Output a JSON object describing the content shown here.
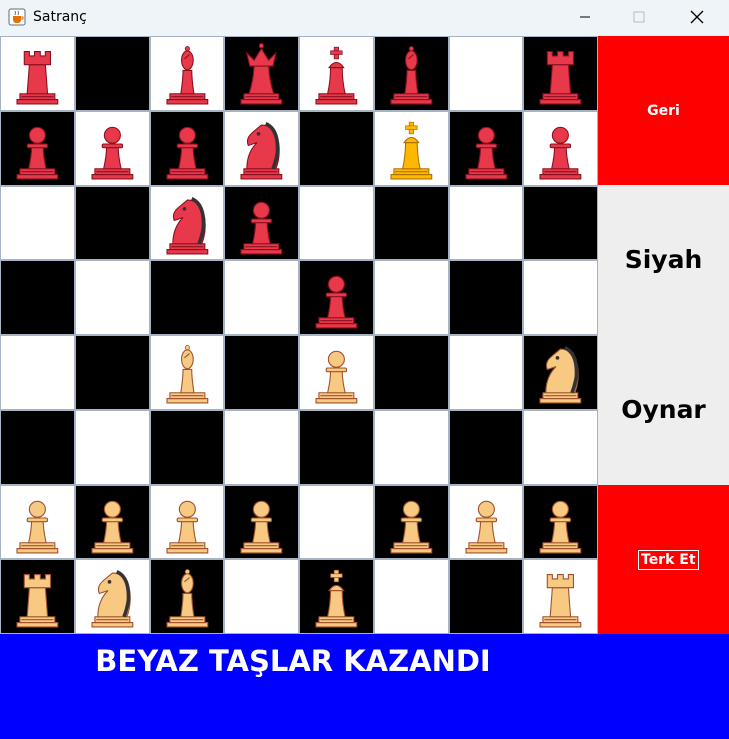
{
  "window": {
    "title": "Satranç",
    "icon": "java-cup-icon"
  },
  "colors": {
    "red_piece": "#e8394b",
    "white_piece": "#f7c982",
    "highlight_king": "#ffb800",
    "button_red": "#ff0000",
    "banner_blue": "#0000ff"
  },
  "side_panel": {
    "back_button_label": "Geri",
    "turn_line1": "Siyah",
    "turn_line2": "Oynar",
    "resign_button_label": "Terk Et"
  },
  "banner": {
    "message": "BEYAZ TAŞLAR KAZANDI"
  },
  "board": [
    [
      "R-rook",
      "",
      "R-bishop",
      "R-queen",
      "R-king",
      "R-bishop",
      "",
      "R-rook"
    ],
    [
      "R-pawn",
      "R-pawn",
      "R-pawn",
      "R-knight",
      "",
      "Y-king",
      "R-pawn",
      "R-pawn"
    ],
    [
      "",
      "",
      "R-knight",
      "R-pawn",
      "",
      "",
      "",
      ""
    ],
    [
      "",
      "",
      "",
      "",
      "R-pawn",
      "",
      "",
      ""
    ],
    [
      "",
      "",
      "W-bishop",
      "",
      "W-pawn",
      "",
      "",
      "W-knight"
    ],
    [
      "",
      "",
      "",
      "",
      "",
      "",
      "",
      ""
    ],
    [
      "W-pawn",
      "W-pawn",
      "W-pawn",
      "W-pawn",
      "",
      "W-pawn",
      "W-pawn",
      "W-pawn"
    ],
    [
      "W-rook",
      "W-knight",
      "W-bishop",
      "",
      "W-king",
      "",
      "",
      "W-rook"
    ]
  ],
  "square_colors": [
    [
      "w",
      "b",
      "w",
      "b",
      "w",
      "b",
      "w",
      "b"
    ],
    [
      "b",
      "w",
      "b",
      "w",
      "b",
      "w",
      "b",
      "w"
    ],
    [
      "w",
      "b",
      "w",
      "b",
      "w",
      "b",
      "w",
      "b"
    ],
    [
      "b",
      "w",
      "b",
      "w",
      "b",
      "w",
      "b",
      "w"
    ],
    [
      "w",
      "b",
      "w",
      "b",
      "w",
      "b",
      "w",
      "b"
    ],
    [
      "b",
      "w",
      "b",
      "w",
      "b",
      "w",
      "b",
      "w"
    ],
    [
      "w",
      "b",
      "w",
      "b",
      "w",
      "b",
      "w",
      "b"
    ],
    [
      "b",
      "w",
      "b",
      "w",
      "b",
      "w",
      "b",
      "w"
    ]
  ]
}
